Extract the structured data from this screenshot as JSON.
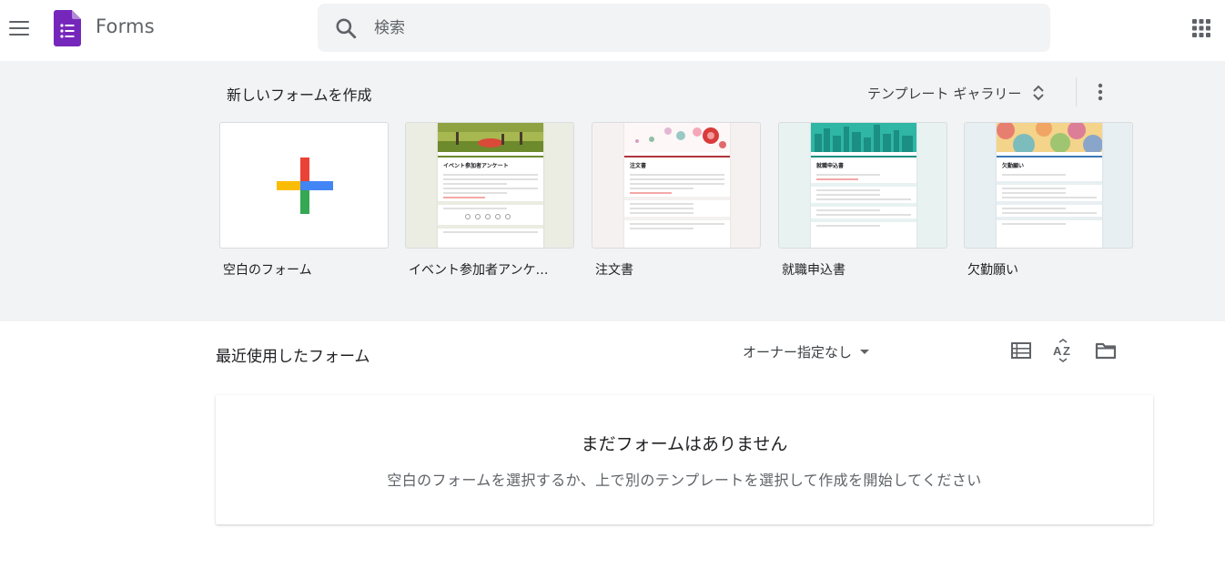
{
  "header": {
    "app_name": "Forms",
    "search_placeholder": "検索"
  },
  "templates": {
    "section_title": "新しいフォームを作成",
    "gallery_label": "テンプレート ギャラリー",
    "cards": [
      {
        "label": "空白のフォーム"
      },
      {
        "label": "イベント参加者アンケ…",
        "doc_title": "イベント参加者アンケート"
      },
      {
        "label": "注文書",
        "doc_title": "注文書"
      },
      {
        "label": "就職申込書",
        "doc_title": "就職申込書"
      },
      {
        "label": "欠勤願い",
        "doc_title": "欠勤願い"
      }
    ]
  },
  "recent": {
    "section_title": "最近使用したフォーム",
    "owner_filter": "オーナー指定なし",
    "empty_title": "まだフォームはありません",
    "empty_subtitle": "空白のフォームを選択するか、上で別のテンプレートを選択して作成を開始してください"
  },
  "colors": {
    "brand_purple": "#7627bb",
    "band_background": "#f1f3f4",
    "plus_blue": "#4285f4",
    "plus_red": "#ea4335",
    "plus_yellow": "#fbbc04",
    "plus_green": "#34a853"
  },
  "icons": {
    "menu": "menu-icon",
    "logo": "forms-logo-icon",
    "search": "search-icon",
    "apps": "apps-grid-icon",
    "gallery_toggle": "unfold-more-icon",
    "more": "more-vert-icon",
    "list_view": "list-view-icon",
    "sort": "sort-az-icon",
    "folder": "folder-icon"
  }
}
